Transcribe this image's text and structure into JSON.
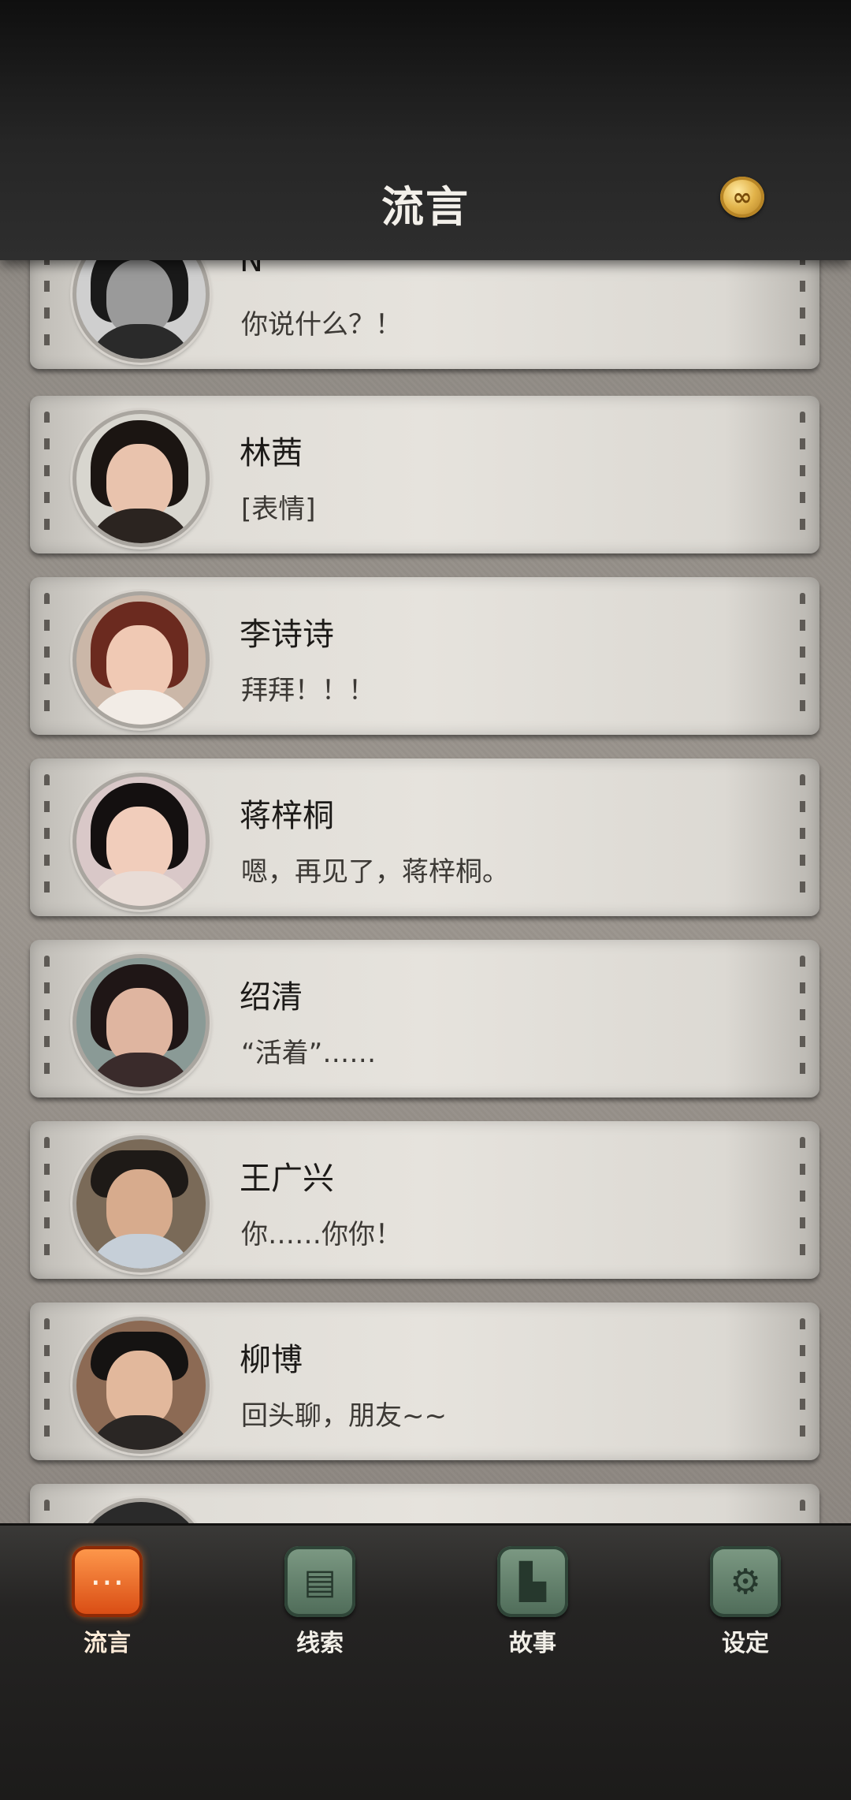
{
  "header": {
    "title": "流言",
    "coin_symbol": "∞"
  },
  "conversations": [
    {
      "name": "N",
      "message": "你说什么？！"
    },
    {
      "name": "林茜",
      "message": "[表情]"
    },
    {
      "name": "李诗诗",
      "message": "拜拜！！！"
    },
    {
      "name": "蒋梓桐",
      "message": "嗯，再见了，蒋梓桐。"
    },
    {
      "name": "绍清",
      "message": "“活着”……"
    },
    {
      "name": "王广兴",
      "message": "你……你你！"
    },
    {
      "name": "柳博",
      "message": "回头聊，朋友~~"
    },
    {
      "name": "",
      "message": ""
    }
  ],
  "tabs": [
    {
      "label": "流言",
      "icon": "chat-bubble-icon",
      "active": true
    },
    {
      "label": "线索",
      "icon": "clue-paper-icon",
      "active": false
    },
    {
      "label": "故事",
      "icon": "story-flag-icon",
      "active": false
    },
    {
      "label": "设定",
      "icon": "gear-icon",
      "active": false
    }
  ],
  "colors": {
    "active_tab": "#e05a1c",
    "inactive_tab": "#5d7b67",
    "coin": "#e2b34a"
  }
}
